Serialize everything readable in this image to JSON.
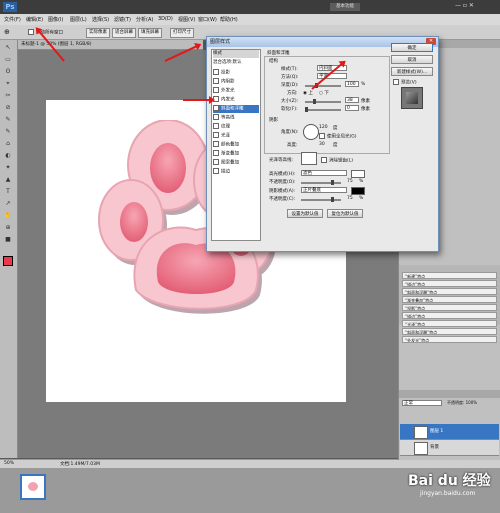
{
  "app": {
    "logo": "Ps",
    "right_label": "基本功能"
  },
  "menu": [
    "文件(F)",
    "编辑(E)",
    "图像(I)",
    "图层(L)",
    "选择(S)",
    "滤镜(T)",
    "分析(A)",
    "3D(D)",
    "视图(V)",
    "窗口(W)",
    "帮助(H)"
  ],
  "options": {
    "scroll_all": "滚动所有窗口",
    "btn1": "实际像素",
    "btn2": "适合屏幕",
    "btn3": "填充屏幕",
    "btn4": "打印尺寸"
  },
  "document": {
    "tab": "未标题-1 @ 50% (图层 1, RGB/8)",
    "zoom": "50%",
    "doc_info": "文档:1.49M/7.03M"
  },
  "dialog": {
    "title": "图层样式",
    "styles_header": "样式",
    "blend_options": "混合选项:默认",
    "style_items": [
      "投影",
      "内阴影",
      "外发光",
      "内发光",
      "斜面和浮雕",
      "等高线",
      "纹理",
      "光泽",
      "颜色叠加",
      "渐变叠加",
      "图案叠加",
      "描边"
    ],
    "section_title": "斜面和浮雕",
    "structure": "结构",
    "style_label": "样式(T):",
    "style_value": "内斜面",
    "method_label": "方法(Q):",
    "method_value": "平滑",
    "depth_label": "深度(D):",
    "depth_value": "100",
    "pct": "%",
    "direction_label": "方向:",
    "dir_up": "上",
    "dir_down": "下",
    "size_label": "大小(Z):",
    "size_value": "38",
    "px": "像素",
    "soften_label": "软化(F):",
    "soften_value": "0",
    "shading": "阴影",
    "angle_label": "角度(N):",
    "angle_value": "120",
    "deg": "度",
    "global_light": "使用全局光(G)",
    "altitude_label": "高度:",
    "altitude_value": "30",
    "gloss_label": "光泽等高线:",
    "antialias": "消除锯齿(L)",
    "highlight_mode_label": "高光模式(H):",
    "highlight_mode_value": "滤色",
    "opacity_label": "不透明度(O):",
    "opacity_value": "75",
    "shadow_mode_label": "阴影模式(A):",
    "shadow_mode_value": "正片叠底",
    "opacity2_label": "不透明度(C):",
    "opacity2_value": "75",
    "default_btn": "设置为默认值",
    "reset_btn": "复位为默认值",
    "ok": "确定",
    "cancel": "取消",
    "new_style": "新建样式(W)...",
    "preview": "预览(V)"
  },
  "right_panel": {
    "tools_label": "工具",
    "history_items": [
      "“新建”特点",
      "“描边”特点",
      "“斜面和浮雕”特点",
      "“渐变叠加”特点",
      "“投影”特点",
      "“描边”特点",
      "“光泽”特点",
      "“斜面和浮雕”特点",
      "“外发光”特点"
    ],
    "layers_mode": "正常",
    "opacity": "不透明度: 100%",
    "layer1": "图层 1",
    "background": "背景"
  },
  "watermark": "Bai du 经验",
  "watermark_url": "jingyan.baidu.com",
  "colors": {
    "accent": "#3876c4",
    "paw_outer": "#f8c6cf",
    "paw_pad": "#e9687d",
    "arrow": "#e01818"
  }
}
